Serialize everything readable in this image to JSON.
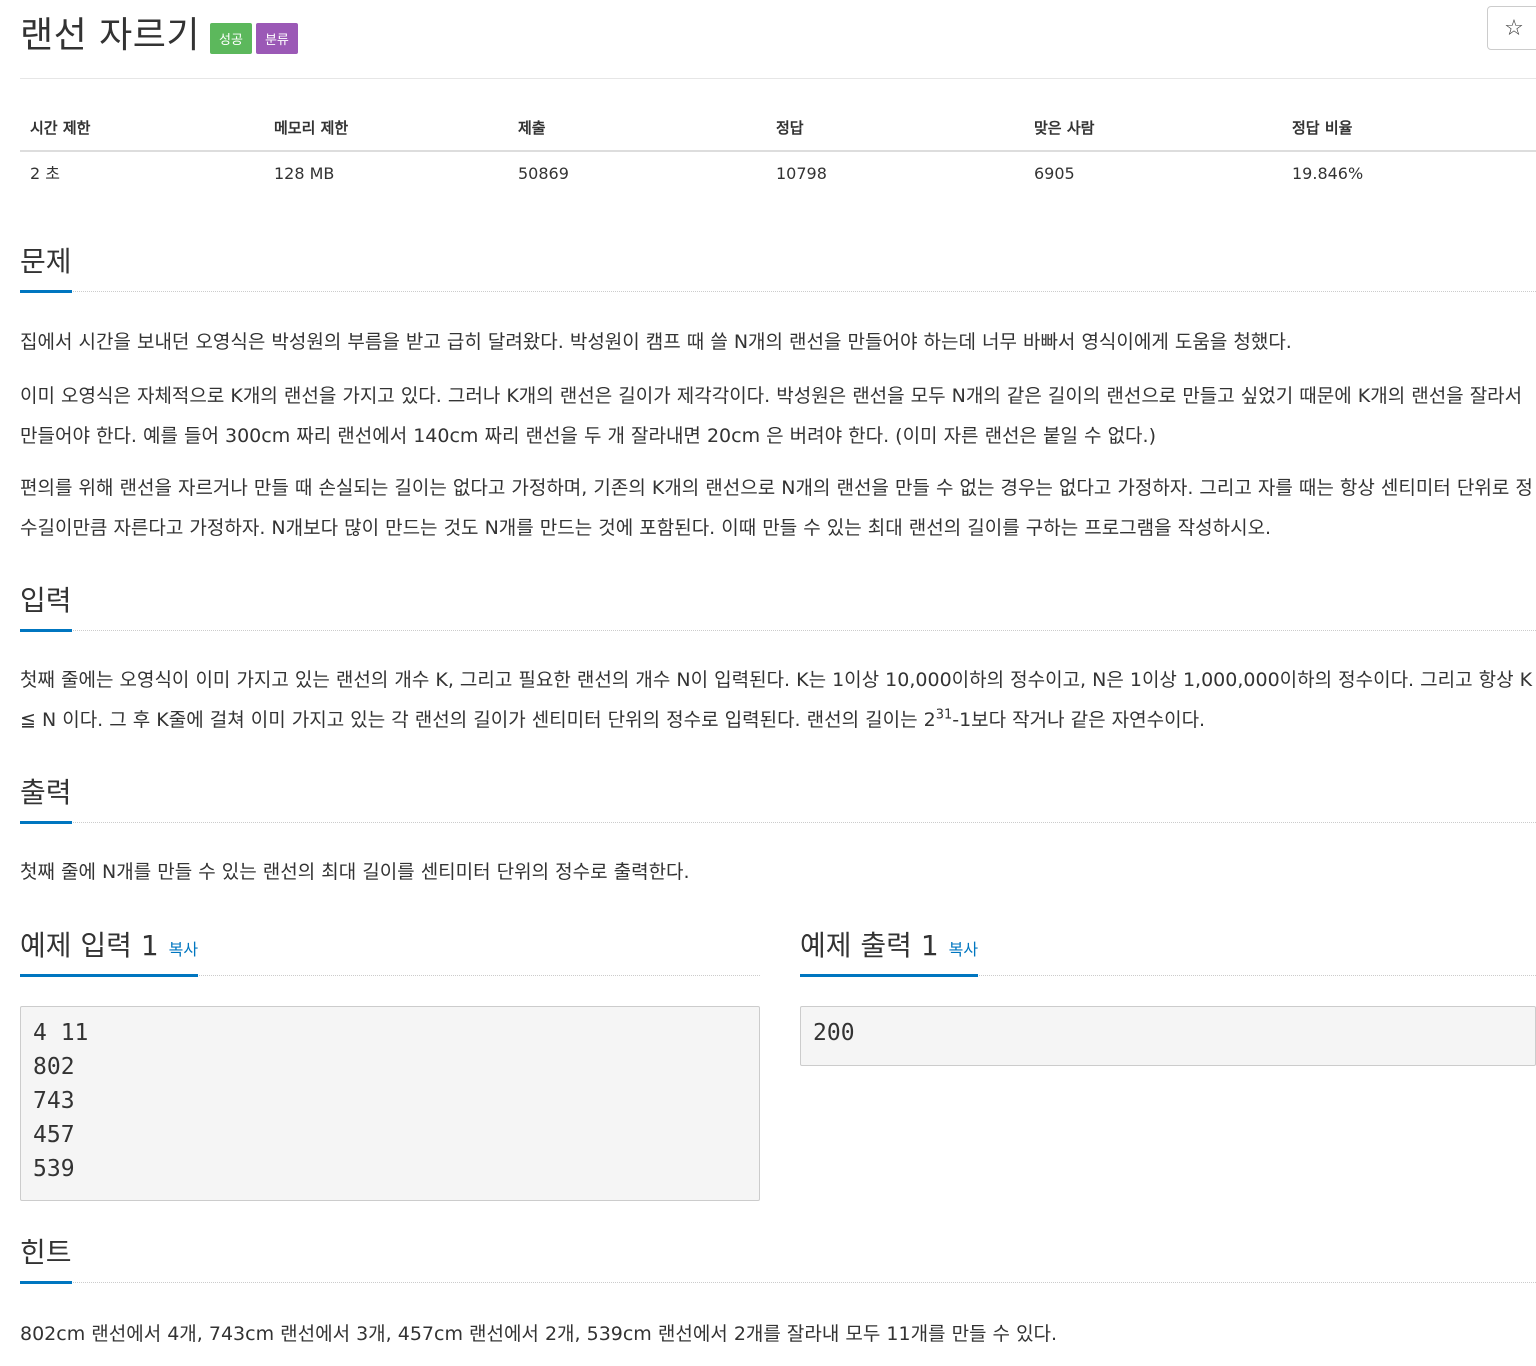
{
  "problem": {
    "title": "랜선 자르기",
    "badges": {
      "success": "성공",
      "category": "분류"
    },
    "star_icon": "☆"
  },
  "info": {
    "headers": [
      "시간 제한",
      "메모리 제한",
      "제출",
      "정답",
      "맞은 사람",
      "정답 비율"
    ],
    "values": [
      "2 초",
      "128 MB",
      "50869",
      "10798",
      "6905",
      "19.846%"
    ]
  },
  "sections": {
    "problem": {
      "heading": "문제",
      "p1": "집에서 시간을 보내던 오영식은 박성원의 부름을 받고 급히 달려왔다. 박성원이 캠프 때 쓸 N개의 랜선을 만들어야 하는데 너무 바빠서 영식이에게 도움을 청했다.",
      "p2": "이미 오영식은 자체적으로 K개의 랜선을 가지고 있다. 그러나 K개의 랜선은 길이가 제각각이다. 박성원은 랜선을 모두 N개의 같은 길이의 랜선으로 만들고 싶었기 때문에 K개의 랜선을 잘라서 만들어야 한다. 예를 들어 300cm 짜리 랜선에서 140cm 짜리 랜선을 두 개 잘라내면 20cm 은 버려야 한다. (이미 자른 랜선은 붙일 수 없다.)",
      "p3": "편의를 위해 랜선을 자르거나 만들 때 손실되는 길이는 없다고 가정하며, 기존의 K개의 랜선으로 N개의 랜선을 만들 수 없는 경우는 없다고 가정하자. 그리고 자를 때는 항상 센티미터 단위로 정수길이만큼 자른다고 가정하자. N개보다 많이 만드는 것도 N개를 만드는 것에 포함된다. 이때 만들 수 있는 최대 랜선의 길이를 구하는 프로그램을 작성하시오."
    },
    "input": {
      "heading": "입력",
      "text_before": "첫째 줄에는 오영식이 이미 가지고 있는 랜선의 개수 K, 그리고 필요한 랜선의 개수 N이 입력된다. K는 1이상 10,000이하의 정수이고, N은 1이상 1,000,000이하의 정수이다. 그리고 항상 K ≦ N 이다. 그 후 K줄에 걸쳐 이미 가지고 있는 각 랜선의 길이가 센티미터 단위의 정수로 입력된다. 랜선의 길이는 2",
      "sup": "31",
      "text_after": "-1보다 작거나 같은 자연수이다."
    },
    "output": {
      "heading": "출력",
      "text": "첫째 줄에 N개를 만들 수 있는 랜선의 최대 길이를 센티미터 단위의 정수로 출력한다."
    },
    "sample_input": {
      "heading": "예제 입력 1",
      "copy": "복사",
      "text": "4 11\n802\n743\n457\n539"
    },
    "sample_output": {
      "heading": "예제 출력 1",
      "copy": "복사",
      "text": "200"
    },
    "hint": {
      "heading": "힌트",
      "text": "802cm 랜선에서 4개, 743cm 랜선에서 3개, 457cm 랜선에서 2개, 539cm 랜선에서 2개를 잘라내 모두 11개를 만들 수 있다."
    }
  }
}
